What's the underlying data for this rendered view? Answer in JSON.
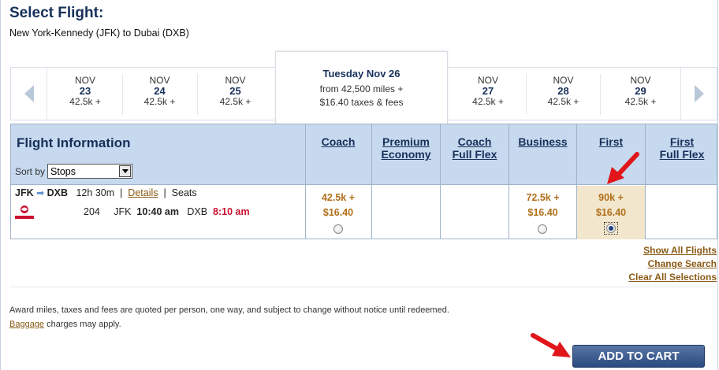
{
  "page": {
    "title": "Select Flight:",
    "route": "New York-Kennedy (JFK) to Dubai (DXB)"
  },
  "date_strip": {
    "prev_icon": "chevron-left-icon",
    "next_icon": "chevron-right-icon",
    "dates_before": [
      {
        "month": "NOV",
        "day": "23",
        "miles": "42.5k +"
      },
      {
        "month": "NOV",
        "day": "24",
        "miles": "42.5k +"
      },
      {
        "month": "NOV",
        "day": "25",
        "miles": "42.5k +"
      }
    ],
    "selected": {
      "title": "Tuesday Nov 26",
      "line1": "from 42,500 miles +",
      "line2": "$16.40 taxes & fees"
    },
    "dates_after": [
      {
        "month": "NOV",
        "day": "27",
        "miles": "42.5k +"
      },
      {
        "month": "NOV",
        "day": "28",
        "miles": "42.5k +"
      },
      {
        "month": "NOV",
        "day": "29",
        "miles": "42.5k +"
      }
    ]
  },
  "table": {
    "info_title": "Flight Information",
    "sort_label": "Sort by",
    "sort_value": "Stops",
    "cabins": [
      {
        "line1": "Coach",
        "line2": ""
      },
      {
        "line1": "Premium",
        "line2": "Economy"
      },
      {
        "line1": "Coach",
        "line2": "Full Flex"
      },
      {
        "line1": "Business",
        "line2": ""
      },
      {
        "line1": "First",
        "line2": ""
      },
      {
        "line1": "First",
        "line2": "Full Flex"
      }
    ],
    "flight": {
      "origin": "JFK",
      "destination": "DXB",
      "duration": "12h 30m",
      "sep": "|",
      "details_link": "Details",
      "seats_label": "Seats",
      "airline_logo": "emirates-logo",
      "flight_number": "204",
      "dep_airport": "JFK",
      "dep_time": "10:40 am",
      "arr_airport": "DXB",
      "arr_time": "8:10 am",
      "prices": {
        "coach": {
          "miles": "42.5k +",
          "fee": "$16.40"
        },
        "business": {
          "miles": "72.5k +",
          "fee": "$16.40"
        },
        "first": {
          "miles": "90k +",
          "fee": "$16.40"
        }
      },
      "selected_cabin": "First"
    }
  },
  "actions": {
    "show_all": "Show All Flights",
    "change_search": "Change Search",
    "clear_all": "Clear All Selections"
  },
  "disclaimer": {
    "line1": "Award miles, taxes and fees are quoted per person, one way, and subject to change without notice until redeemed.",
    "baggage_link": "Baggage",
    "line2_rest": " charges may apply."
  },
  "add_to_cart": "ADD TO CART",
  "colors": {
    "navy": "#17305a",
    "header_blue": "#c6d9ee",
    "price_gold": "#b0701a",
    "selected_cell": "#f2e6cc",
    "red_arrow": "#e0161b",
    "button_blue": "#2a4a80"
  }
}
